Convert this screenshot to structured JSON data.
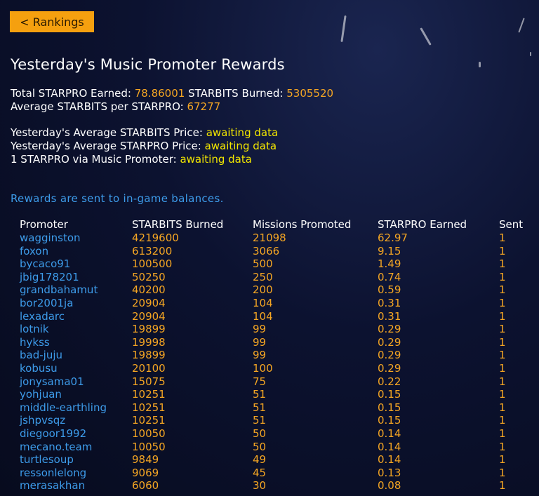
{
  "nav": {
    "back_label": "< Rankings"
  },
  "page_title": "Yesterday's Music Promoter Rewards",
  "summary": {
    "total_starpro_label": "Total STARPRO Earned:",
    "total_starpro_value": "78.86001",
    "starbits_burned_label": "STARBITS Burned:",
    "starbits_burned_value": "5305520",
    "avg_starbits_label": "Average STARBITS per STARPRO:",
    "avg_starbits_value": "67277"
  },
  "prices": {
    "avg_starbits_price_label": "Yesterday's Average STARBITS Price:",
    "avg_starbits_price_value": "awaiting data",
    "avg_starpro_price_label": "Yesterday's Average STARPRO Price:",
    "avg_starpro_price_value": "awaiting data",
    "via_promoter_label": "1 STARPRO via Music Promoter:",
    "via_promoter_value": "awaiting data"
  },
  "note": "Rewards are sent to in-game balances.",
  "table": {
    "headers": [
      "Promoter",
      "STARBITS Burned",
      "Missions Promoted",
      "STARPRO Earned",
      "Sent"
    ],
    "rows": [
      [
        "wagginston",
        "4219600",
        "21098",
        "62.97",
        "1"
      ],
      [
        "foxon",
        "613200",
        "3066",
        "9.15",
        "1"
      ],
      [
        "bycaco91",
        "100500",
        "500",
        "1.49",
        "1"
      ],
      [
        "jbig178201",
        "50250",
        "250",
        "0.74",
        "1"
      ],
      [
        "grandbahamut",
        "40200",
        "200",
        "0.59",
        "1"
      ],
      [
        "bor2001ja",
        "20904",
        "104",
        "0.31",
        "1"
      ],
      [
        "lexadarc",
        "20904",
        "104",
        "0.31",
        "1"
      ],
      [
        "lotnik",
        "19899",
        "99",
        "0.29",
        "1"
      ],
      [
        "hykss",
        "19998",
        "99",
        "0.29",
        "1"
      ],
      [
        "bad-juju",
        "19899",
        "99",
        "0.29",
        "1"
      ],
      [
        "kobusu",
        "20100",
        "100",
        "0.29",
        "1"
      ],
      [
        "jonysama01",
        "15075",
        "75",
        "0.22",
        "1"
      ],
      [
        "yohjuan",
        "10251",
        "51",
        "0.15",
        "1"
      ],
      [
        "middle-earthling",
        "10251",
        "51",
        "0.15",
        "1"
      ],
      [
        "jshpvsqz",
        "10251",
        "51",
        "0.15",
        "1"
      ],
      [
        "diegoor1992",
        "10050",
        "50",
        "0.14",
        "1"
      ],
      [
        "mecano.team",
        "10050",
        "50",
        "0.14",
        "1"
      ],
      [
        "turtlesoup",
        "9849",
        "49",
        "0.14",
        "1"
      ],
      [
        "ressonlelong",
        "9069",
        "45",
        "0.13",
        "1"
      ],
      [
        "merasakhan",
        "6060",
        "30",
        "0.08",
        "1"
      ]
    ]
  }
}
